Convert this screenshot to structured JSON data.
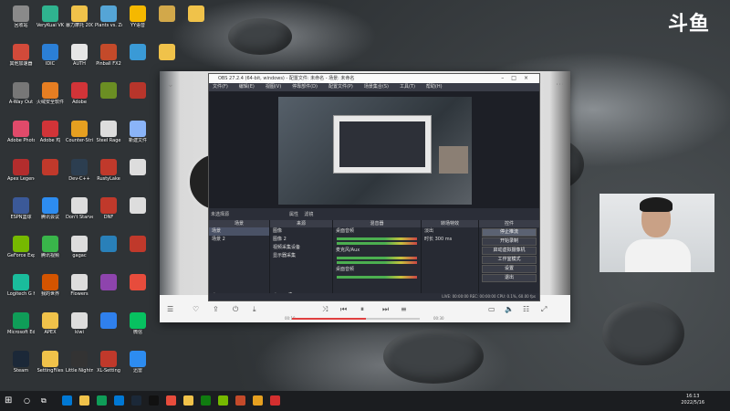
{
  "brand": {
    "logo_text": "斗鱼"
  },
  "desktop": {
    "icons": [
      {
        "label": "回收站",
        "color": "#8a8a8a",
        "col": 0,
        "row": 0
      },
      {
        "label": "VeryKuai VK 加速器",
        "color": "#2fb38f",
        "col": 1,
        "row": 0
      },
      {
        "label": "暴力摩托 2002",
        "color": "#f0c24a",
        "col": 2,
        "row": 0
      },
      {
        "label": "Plants vs. Zombies...",
        "color": "#55a5d6",
        "col": 3,
        "row": 0
      },
      {
        "label": "YY语音",
        "color": "#f5b800",
        "col": 4,
        "row": 0
      },
      {
        "label": "",
        "color": "#d2a84a",
        "col": 5,
        "row": 0
      },
      {
        "label": "",
        "color": "#f0c24a",
        "col": 6,
        "row": 0
      },
      {
        "label": "其他加速器",
        "color": "#d24a3a",
        "col": 0,
        "row": 1
      },
      {
        "label": "IDIC",
        "color": "#2b7fd6",
        "col": 1,
        "row": 1
      },
      {
        "label": "AUTH",
        "color": "#e6e6e6",
        "col": 2,
        "row": 1
      },
      {
        "label": "Pinball FX2",
        "color": "#c44a2a",
        "col": 3,
        "row": 1
      },
      {
        "label": "",
        "color": "#3a9ad6",
        "col": 4,
        "row": 1
      },
      {
        "label": "",
        "color": "#f0c24a",
        "col": 5,
        "row": 1
      },
      {
        "label": "A-Way Out",
        "color": "#777",
        "col": 0,
        "row": 2
      },
      {
        "label": "火绒安全软件",
        "color": "#e67e22",
        "col": 1,
        "row": 2
      },
      {
        "label": "Adobe",
        "color": "#d13438",
        "col": 2,
        "row": 2
      },
      {
        "label": "",
        "color": "#6b8e23",
        "col": 3,
        "row": 2
      },
      {
        "label": "",
        "color": "#b7352b",
        "col": 4,
        "row": 2
      },
      {
        "label": "Adobe Photoshop",
        "color": "#e04a6a",
        "col": 0,
        "row": 3
      },
      {
        "label": "Adobe 鸡",
        "color": "#d13438",
        "col": 1,
        "row": 3
      },
      {
        "label": "Counter-Strike Global",
        "color": "#e6a020",
        "col": 2,
        "row": 3
      },
      {
        "label": "Steel Rage",
        "color": "#ddd",
        "col": 3,
        "row": 3
      },
      {
        "label": "新建文件",
        "color": "#8ab4f8",
        "col": 4,
        "row": 3
      },
      {
        "label": "Apex Legends",
        "color": "#b32d2d",
        "col": 0,
        "row": 4
      },
      {
        "label": "",
        "color": "#c0392b",
        "col": 1,
        "row": 4
      },
      {
        "label": "Dev-C++",
        "color": "#2c3e50",
        "col": 2,
        "row": 4
      },
      {
        "label": "RustyLake",
        "color": "#c0392b",
        "col": 3,
        "row": 4
      },
      {
        "label": "",
        "color": "#ddd",
        "col": 4,
        "row": 4
      },
      {
        "label": "ESPN篮球",
        "color": "#3b5998",
        "col": 0,
        "row": 5
      },
      {
        "label": "腾讯会议",
        "color": "#2d8cf0",
        "col": 1,
        "row": 5
      },
      {
        "label": "Don't Starve",
        "color": "#ddd",
        "col": 2,
        "row": 5
      },
      {
        "label": "DNF",
        "color": "#c0392b",
        "col": 3,
        "row": 5
      },
      {
        "label": "",
        "color": "#ddd",
        "col": 4,
        "row": 5
      },
      {
        "label": "GeForce Experience",
        "color": "#76b900",
        "col": 0,
        "row": 6
      },
      {
        "label": "腾讯视频",
        "color": "#39b54a",
        "col": 1,
        "row": 6
      },
      {
        "label": "gagac",
        "color": "#ddd",
        "col": 2,
        "row": 6
      },
      {
        "label": "",
        "color": "#2980b9",
        "col": 3,
        "row": 6
      },
      {
        "label": "",
        "color": "#c0392b",
        "col": 4,
        "row": 6
      },
      {
        "label": "Logitech G HUB",
        "color": "#1abc9c",
        "col": 0,
        "row": 7
      },
      {
        "label": "我的世界",
        "color": "#d35400",
        "col": 1,
        "row": 7
      },
      {
        "label": "Flowers",
        "color": "#ddd",
        "col": 2,
        "row": 7
      },
      {
        "label": "",
        "color": "#8e44ad",
        "col": 3,
        "row": 7
      },
      {
        "label": "",
        "color": "#e74c3c",
        "col": 4,
        "row": 7
      },
      {
        "label": "Microsoft Edge",
        "color": "#0f9d58",
        "col": 0,
        "row": 8
      },
      {
        "label": "APEX",
        "color": "#f0c24a",
        "col": 1,
        "row": 8
      },
      {
        "label": "kiwi",
        "color": "#ddd",
        "col": 2,
        "row": 8
      },
      {
        "label": "",
        "color": "#2f80ed",
        "col": 3,
        "row": 8
      },
      {
        "label": "微信",
        "color": "#07c160",
        "col": 4,
        "row": 8
      },
      {
        "label": "Steam",
        "color": "#1b2838",
        "col": 0,
        "row": 9
      },
      {
        "label": "SettingFiles",
        "color": "#f0c24a",
        "col": 1,
        "row": 9
      },
      {
        "label": "Little Nightmares",
        "color": "#333",
        "col": 2,
        "row": 9
      },
      {
        "label": "XL-Setting",
        "color": "#c0392b",
        "col": 3,
        "row": 9
      },
      {
        "label": "迅雷",
        "color": "#2d8cf0",
        "col": 4,
        "row": 9
      }
    ]
  },
  "obs": {
    "title": "OBS 27.2.4 (64-bit, windows) - 配置文件: 未命名 - 场景: 未命名",
    "menu": [
      "文件(F)",
      "编辑(E)",
      "视图(V)",
      "停靠部件(D)",
      "配置文件(P)",
      "场景集合(S)",
      "工具(T)",
      "帮助(H)"
    ],
    "preview_label": "未选择源",
    "preview_buttons": [
      "属性",
      "滤镜"
    ],
    "docks": {
      "scenes": {
        "title": "场景",
        "items": [
          "场景",
          "场景 2"
        ]
      },
      "sources": {
        "title": "来源",
        "items": [
          "图像",
          "图像 2",
          "视频采集设备",
          "显示器采集"
        ]
      },
      "mixer": {
        "title": "混音器",
        "tracks": [
          "桌面音频",
          "麦克风/Aux",
          "桌面音频"
        ]
      },
      "transitions": {
        "title": "转场特效",
        "type": "淡出",
        "duration_label": "时长",
        "duration": "300 ms"
      },
      "controls": {
        "title": "控件",
        "buttons": [
          "停止推流",
          "开始录制",
          "启动虚拟摄像机",
          "工作室模式",
          "设置",
          "退出"
        ],
        "active_index": 0
      }
    },
    "status": "LIVE: 00:00:00   REC: 00:00:00   CPU: 0.1%, 60.00 fps"
  },
  "player": {
    "time_current": "00:18",
    "time_duration": "00:30",
    "progress": 0.58,
    "controls": [
      "list-icon",
      "heart-icon",
      "share-icon",
      "power-icon",
      "download-icon",
      "prev-icon",
      "pause-icon",
      "next-icon",
      "shuffle-icon"
    ]
  },
  "taskbar": {
    "time": "16:13",
    "date": "2022/5/16",
    "apps": [
      "#0078d4",
      "#f0c24a",
      "#0f9d58",
      "#0078d4",
      "#1b2838",
      "#111",
      "#e74c3c",
      "#f0c24a",
      "#107c10",
      "#76b900",
      "#c44a2a",
      "#e6a020",
      "#d32f2f"
    ]
  }
}
